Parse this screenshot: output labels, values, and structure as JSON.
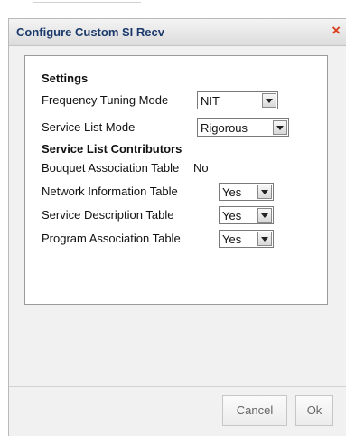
{
  "dialog": {
    "title": "Configure Custom SI Recv",
    "close_glyph": "×",
    "close_icon": "close-icon"
  },
  "settings": {
    "heading": "Settings",
    "frequency_tuning_mode": {
      "label": "Frequency Tuning Mode",
      "value": "NIT"
    },
    "service_list_mode": {
      "label": "Service List Mode",
      "value": "Rigorous"
    }
  },
  "contributors": {
    "heading": "Service List Contributors",
    "bouquet": {
      "label": "Bouquet Association Table",
      "value": "No"
    },
    "network": {
      "label": "Network Information Table",
      "value": "Yes"
    },
    "service_desc": {
      "label": "Service Description Table",
      "value": "Yes"
    },
    "program": {
      "label": "Program Association Table",
      "value": "Yes"
    }
  },
  "buttons": {
    "cancel": "Cancel",
    "ok": "Ok"
  },
  "colors": {
    "title_text": "#1b3a6b",
    "close_icon": "#d8401c"
  }
}
